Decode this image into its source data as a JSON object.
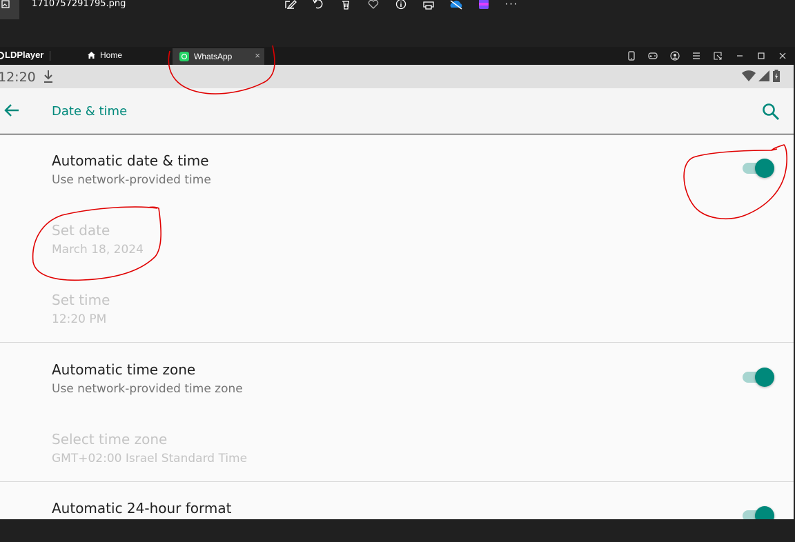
{
  "viewer": {
    "filename": "1710757291795.png",
    "tools": [
      "edit-icon",
      "rotate-icon",
      "delete-icon",
      "favorite-icon",
      "info-icon",
      "print-icon",
      "onedrive-icon",
      "clipchamp-icon",
      "more-icon"
    ],
    "more_label": "···"
  },
  "emulator": {
    "app_name": "LDPlayer",
    "tabs": [
      {
        "label": "Home",
        "icon": "home-icon"
      },
      {
        "label": "WhatsApp",
        "icon": "whatsapp-icon",
        "close": "×"
      }
    ],
    "controls": [
      "phone-icon",
      "gamepad-icon",
      "account-icon",
      "menu-icon",
      "resize-icon",
      "minimize-icon",
      "maximize-icon",
      "close-icon"
    ]
  },
  "status_bar": {
    "time": "12:20",
    "icons": [
      "download-icon",
      "wifi-icon",
      "signal-icon",
      "battery-icon"
    ]
  },
  "toolbar": {
    "title": "Date & time"
  },
  "settings": [
    {
      "title": "Automatic date & time",
      "summary": "Use network-provided time",
      "toggle": true,
      "enabled": true
    },
    {
      "title": "Set date",
      "summary": "March 18, 2024",
      "enabled": false
    },
    {
      "title": "Set time",
      "summary": "12:20 PM",
      "enabled": false
    },
    {
      "title": "Automatic time zone",
      "summary": "Use network-provided time zone",
      "toggle": true,
      "enabled": true
    },
    {
      "title": "Select time zone",
      "summary": "GMT+02:00 Israel Standard Time",
      "enabled": false
    },
    {
      "title": "Automatic 24-hour format",
      "toggle": true,
      "enabled": true
    }
  ],
  "colors": {
    "accent": "#00897b",
    "toggle_track": "#a7d5d0",
    "annotation": "#e00000"
  }
}
